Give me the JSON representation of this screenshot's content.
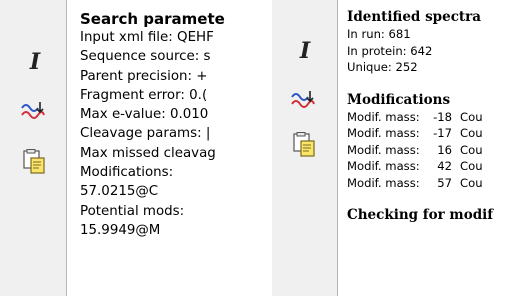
{
  "left_panel": {
    "toolbar": {
      "buttons": [
        {
          "icon": "italic-i-icon"
        },
        {
          "icon": "spectrum-swap-icon"
        },
        {
          "icon": "paste-document-icon"
        }
      ]
    },
    "title": "Search paramete",
    "lines": [
      "Input xml file: QEHF",
      "Sequence source: s",
      "Parent precision: +",
      "Fragment error: 0.(",
      "Max e-value: 0.010",
      "Cleavage params: |",
      "Max missed cleavag",
      "Modifications:",
      "57.0215@C",
      "Potential mods:",
      "15.9949@M"
    ]
  },
  "right_panel": {
    "toolbar": {
      "buttons": [
        {
          "icon": "italic-i-icon"
        },
        {
          "icon": "spectrum-swap-icon"
        },
        {
          "icon": "paste-document-icon"
        }
      ]
    },
    "identified_title": "Identified spectra",
    "identified_lines": [
      "In run: 681",
      "In protein: 642",
      "Unique: 252"
    ],
    "modifications_title": "Modifications",
    "modifications": [
      {
        "label": "Modif. mass:",
        "value": "-18",
        "tail": "Cou"
      },
      {
        "label": "Modif. mass:",
        "value": "-17",
        "tail": "Cou"
      },
      {
        "label": "Modif. mass:",
        "value": "16",
        "tail": "Cou"
      },
      {
        "label": "Modif. mass:",
        "value": "42",
        "tail": "Cou"
      },
      {
        "label": "Modif. mass:",
        "value": "57",
        "tail": "Cou"
      }
    ],
    "checking_title": "Checking for modif"
  },
  "colors": {
    "toolbar_bg": "#f0f0f0",
    "content_bg": "#ffffff",
    "border": "#b8b8b8",
    "wave_red": "#d0303a",
    "wave_blue": "#2a55c8"
  }
}
